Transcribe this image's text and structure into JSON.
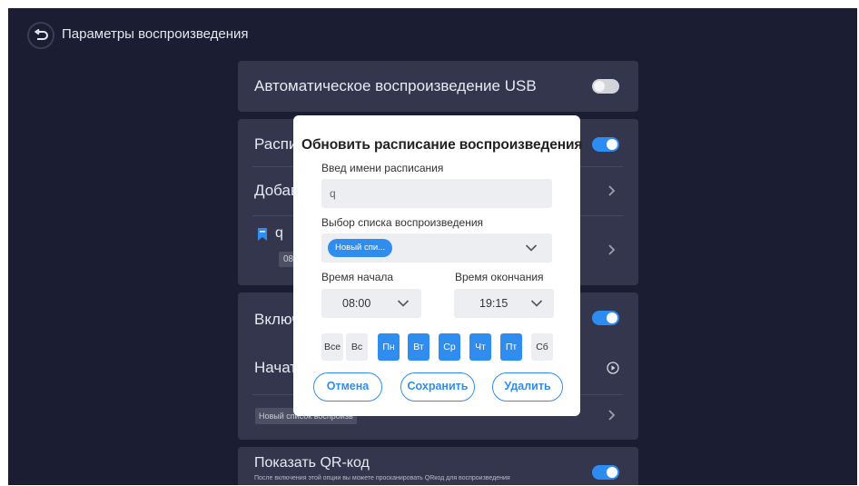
{
  "header": {
    "title": "Параметры воспроизведения",
    "back_icon": "return-icon"
  },
  "settings": {
    "usb_autoplay": {
      "label": "Автоматическое воспроизведение USB",
      "enabled": false
    },
    "schedule": {
      "label": "Расписание",
      "enabled": true
    },
    "add_schedule": {
      "label": "Добавить расписание"
    },
    "schedule_entry": {
      "name": "q",
      "time": "08:00"
    },
    "power_on": {
      "label": "Включение",
      "enabled": true
    },
    "start": {
      "label": "Начать"
    },
    "playlist_tag": "Новый список воспроизв",
    "qr": {
      "label": "Показать QR-код",
      "hint": "После включения этой опции вы можете просканировать QRкод для воспроизведения",
      "enabled": true
    }
  },
  "dialog": {
    "title": "Обновить расписание воспроизведения",
    "name_label": "Введ имени расписания",
    "name_value": "q",
    "playlist_label": "Выбор списка воспроизведения",
    "playlist_selected": "Новый спи...",
    "start_label": "Время начала",
    "start_value": "08:00",
    "end_label": "Время окончания",
    "end_value": "19:15",
    "days": [
      {
        "label": "Все",
        "selected": false
      },
      {
        "label": "Вс",
        "selected": false
      },
      {
        "label": "Пн",
        "selected": true
      },
      {
        "label": "Вт",
        "selected": true
      },
      {
        "label": "Ср",
        "selected": true
      },
      {
        "label": "Чт",
        "selected": true
      },
      {
        "label": "Пт",
        "selected": true
      },
      {
        "label": "Сб",
        "selected": false
      }
    ],
    "cancel": "Отмена",
    "save": "Сохранить",
    "delete": "Удалить"
  },
  "colors": {
    "background": "#1b1d33",
    "card": "#33364d",
    "accent": "#2f8df0"
  }
}
